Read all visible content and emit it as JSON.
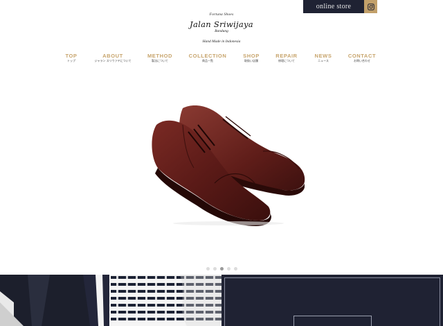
{
  "header": {
    "online_store_label": "online store",
    "instagram_icon": "instagram-icon"
  },
  "logo": {
    "tagline": "Fortuna Shoes",
    "name": "Jalan Sriwijaya",
    "city": "Bandung",
    "handmade": "Hand Made in Indonesia"
  },
  "nav": {
    "items": [
      {
        "en": "TOP",
        "jp": "トップ"
      },
      {
        "en": "ABOUT",
        "jp": "ジャラン スリウァヤについて"
      },
      {
        "en": "METHOD",
        "jp": "製法について"
      },
      {
        "en": "COLLECTION",
        "jp": "商品一覧"
      },
      {
        "en": "SHOP",
        "jp": "取扱い店舗"
      },
      {
        "en": "REPAIR",
        "jp": "修理について"
      },
      {
        "en": "NEWS",
        "jp": "ニュース"
      },
      {
        "en": "CONTACT",
        "jp": "お問い合わせ"
      }
    ]
  },
  "hero": {
    "image": "brown-cap-toe-oxford-shoes",
    "slide_count": 5,
    "active_slide": 3
  },
  "colors": {
    "navy": "#1f2233",
    "gold": "#c7a46c",
    "shoe": "#5a1a17"
  }
}
